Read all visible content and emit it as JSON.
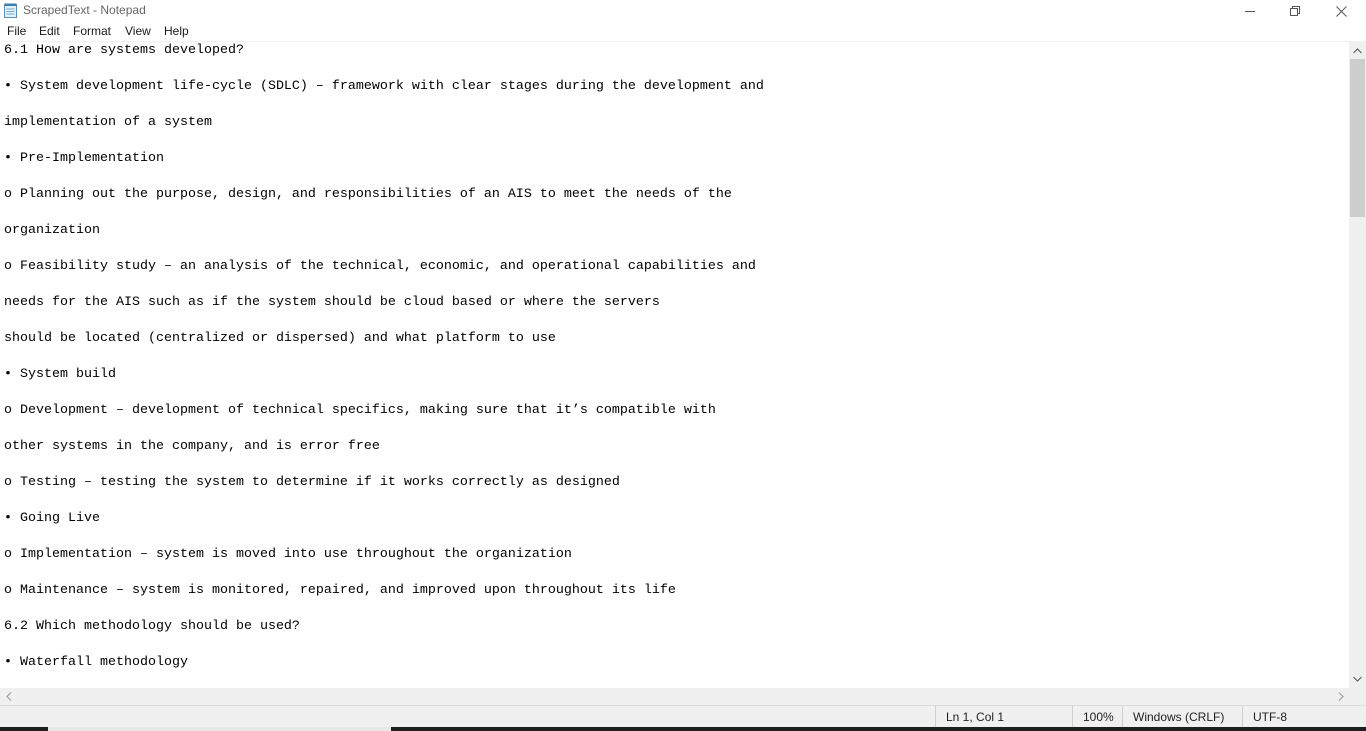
{
  "window": {
    "title": "ScrapedText - Notepad"
  },
  "icons": {
    "app": "notepad-icon",
    "minimize": "minimize-icon",
    "maximize": "restore-icon",
    "close": "close-icon"
  },
  "menu": {
    "items": [
      "File",
      "Edit",
      "Format",
      "View",
      "Help"
    ]
  },
  "editor": {
    "lines": [
      "6.1 How are systems developed?",
      "• System development life-cycle (SDLC) – framework with clear stages during the development and",
      "implementation of a system",
      "• Pre-Implementation",
      "o Planning out the purpose, design, and responsibilities of an AIS to meet the needs of the",
      "organization",
      "o Feasibility study – an analysis of the technical, economic, and operational capabilities and",
      "needs for the AIS such as if the system should be cloud based or where the servers",
      "should be located (centralized or dispersed) and what platform to use",
      "• System build",
      "o Development – development of technical specifics, making sure that it’s compatible with",
      "other systems in the company, and is error free",
      "o Testing – testing the system to determine if it works correctly as designed",
      "• Going Live",
      "o Implementation – system is moved into use throughout the organization",
      "o Maintenance – system is monitored, repaired, and improved upon throughout its life",
      "6.2 Which methodology should be used?",
      "• Waterfall methodology"
    ]
  },
  "status": {
    "position": "Ln 1, Col 1",
    "zoom": "100%",
    "line_ending": "Windows (CRLF)",
    "encoding": "UTF-8"
  }
}
